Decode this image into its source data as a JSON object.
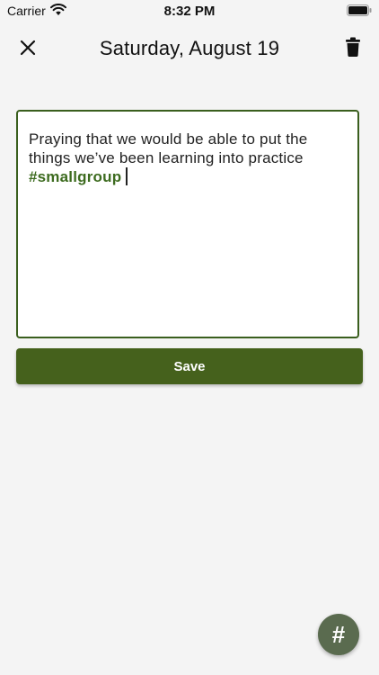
{
  "status_bar": {
    "carrier": "Carrier",
    "time": "8:32 PM",
    "wifi_icon": "wifi-icon",
    "battery_icon": "battery-icon"
  },
  "header": {
    "title": "Saturday, August 19",
    "close_icon": "close-icon",
    "delete_icon": "trash-icon"
  },
  "note": {
    "text": "Praying that we would be able to put the things we’ve been learning into practice",
    "hashtag": "#smallgroup"
  },
  "save_button": {
    "label": "Save"
  },
  "fab": {
    "label": "#"
  },
  "colors": {
    "accent": "#45611c",
    "hashtag": "#3d6b1f",
    "border": "#3a5f1e",
    "fab": "#5a6b4f",
    "background": "#f4f4f4"
  }
}
